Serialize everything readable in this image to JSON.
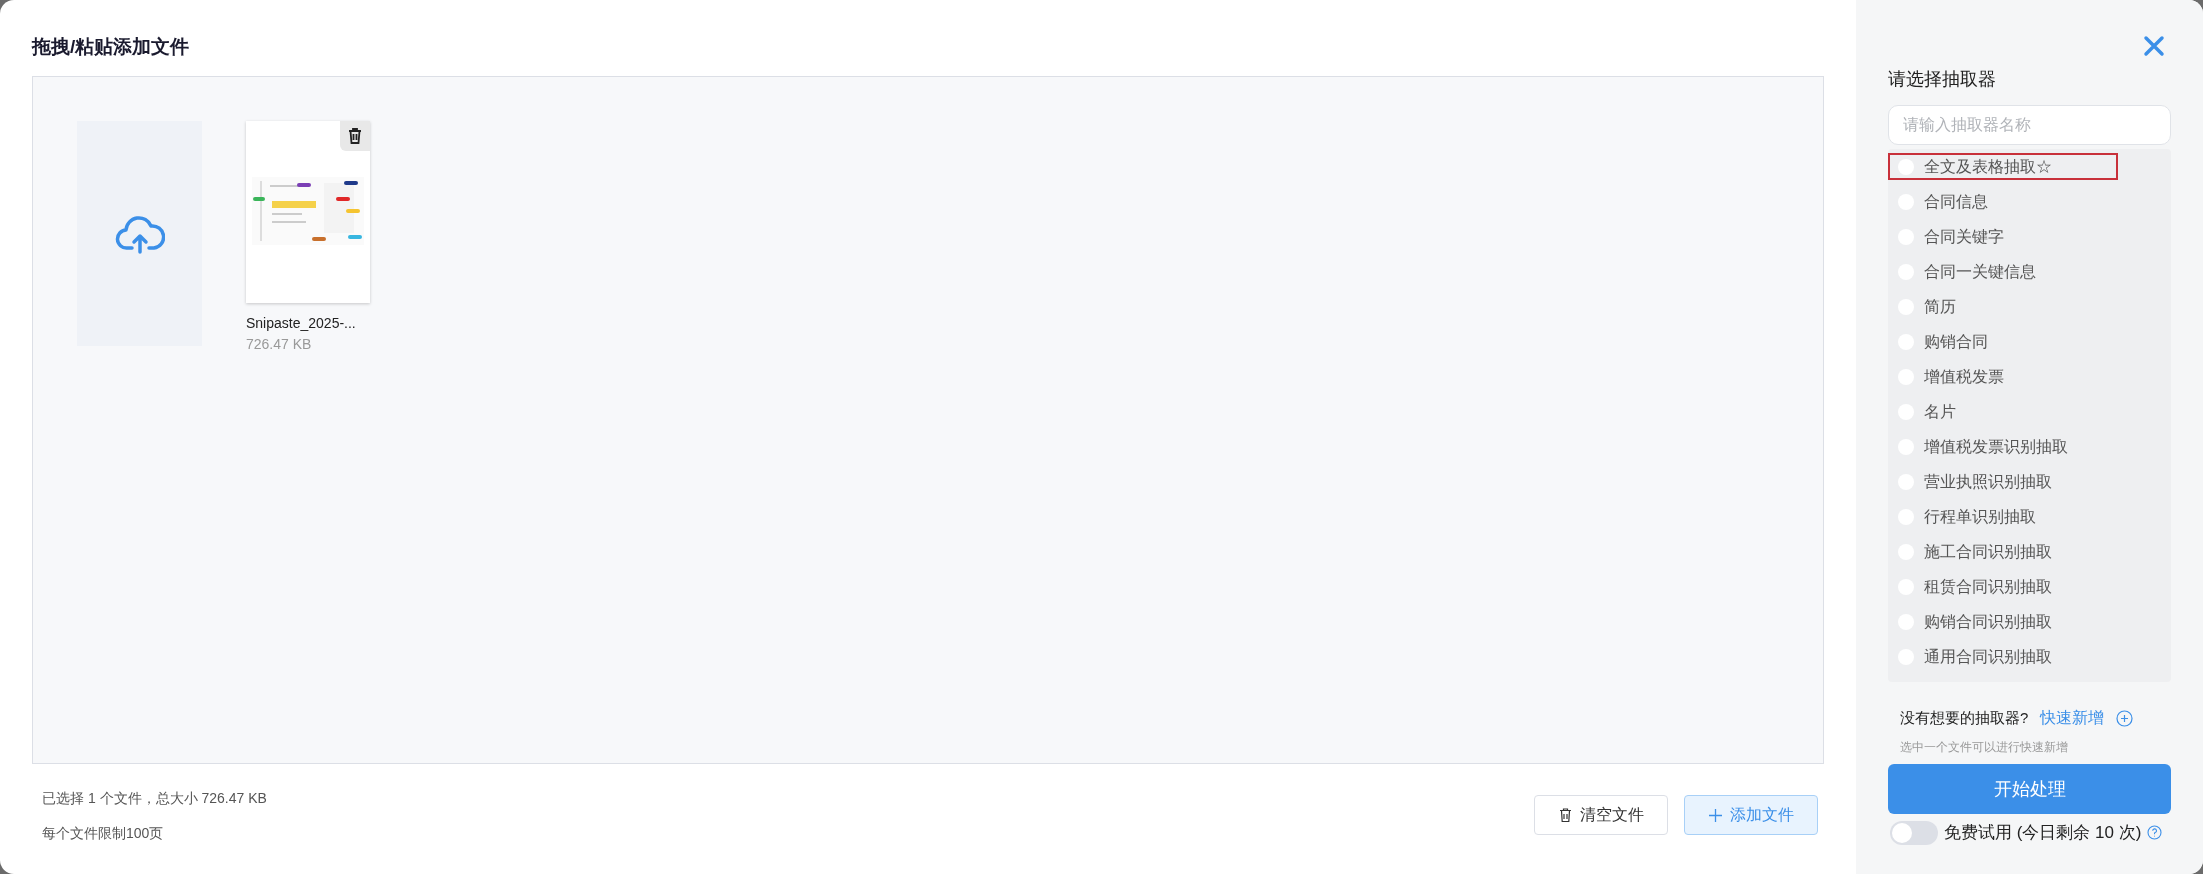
{
  "dialog": {
    "title": "拖拽/粘贴添加文件"
  },
  "files": [
    {
      "name": "Snipaste_2025-...",
      "size": "726.47 KB",
      "kind": "picture"
    }
  ],
  "summary": "已选择 1 个文件，总大小 726.47 KB",
  "limit_note": "每个文件限制100页",
  "buttons": [
    {
      "label": "清空文件",
      "kind": "clear"
    },
    {
      "label": "添加文件",
      "kind": "add"
    }
  ],
  "extractor_panel": {
    "title": "请选择抽取器",
    "search": {
      "placeholder": "请输入抽取器名称"
    },
    "items": [
      {
        "label": "全文及表格抽取☆",
        "selected": false,
        "highlighted": true
      },
      {
        "label": "合同信息",
        "selected": false,
        "highlighted": false
      },
      {
        "label": "合同关键字",
        "selected": false,
        "highlighted": false
      },
      {
        "label": "合同一关键信息",
        "selected": false,
        "highlighted": false
      },
      {
        "label": "简历",
        "selected": false,
        "highlighted": false
      },
      {
        "label": "购销合同",
        "selected": false,
        "highlighted": false
      },
      {
        "label": "增值税发票",
        "selected": false,
        "highlighted": false
      },
      {
        "label": "名片",
        "selected": false,
        "highlighted": false
      },
      {
        "label": "增值税发票识别抽取",
        "selected": false,
        "highlighted": false
      },
      {
        "label": "营业执照识别抽取",
        "selected": false,
        "highlighted": false
      },
      {
        "label": "行程单识别抽取",
        "selected": false,
        "highlighted": false
      },
      {
        "label": "施工合同识别抽取",
        "selected": false,
        "highlighted": false
      },
      {
        "label": "租赁合同识别抽取",
        "selected": false,
        "highlighted": false
      },
      {
        "label": "购销合同识别抽取",
        "selected": false,
        "highlighted": false
      },
      {
        "label": "通用合同识别抽取",
        "selected": false,
        "highlighted": false
      }
    ],
    "missing_prompt": "没有想要的抽取器?",
    "quick_add": "快速新增",
    "quick_add_hint": "选中一个文件可以进行快速新增",
    "start_button": "开始处理",
    "free_trial": {
      "label": "免费试用 (今日剩余 10 次)",
      "on": false
    }
  }
}
